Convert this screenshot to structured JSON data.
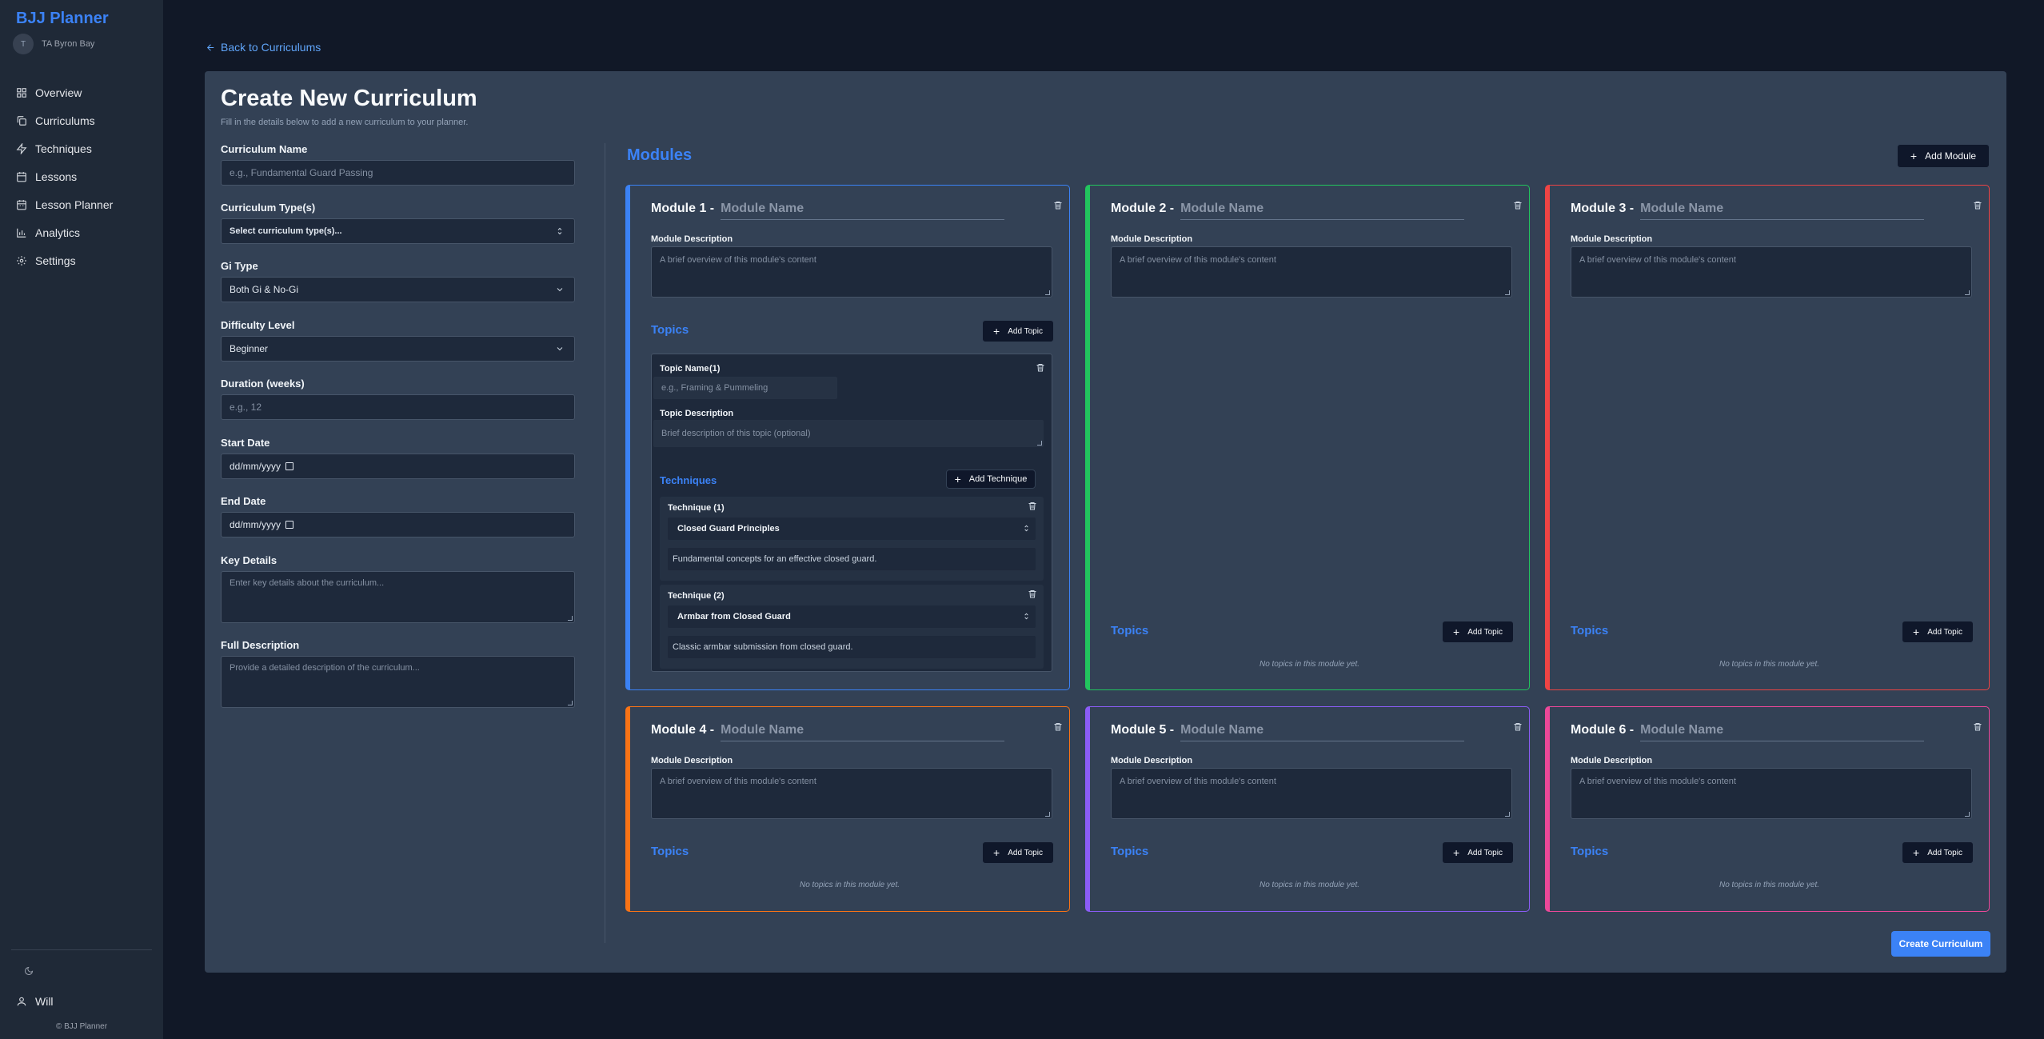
{
  "app": {
    "brand": "BJJ Planner",
    "account_initial": "T",
    "account_name": "TA Byron Bay"
  },
  "nav": [
    {
      "label": "Overview",
      "icon": "grid-icon"
    },
    {
      "label": "Curriculums",
      "icon": "copy-icon"
    },
    {
      "label": "Techniques",
      "icon": "zap-icon"
    },
    {
      "label": "Lessons",
      "icon": "calendar-icon"
    },
    {
      "label": "Lesson Planner",
      "icon": "calendar-icon"
    },
    {
      "label": "Analytics",
      "icon": "bar-chart-icon"
    },
    {
      "label": "Settings",
      "icon": "gear-icon"
    }
  ],
  "footer": {
    "user": "Will",
    "copyright": "© BJJ Planner"
  },
  "back_link": "Back to Curriculums",
  "page": {
    "title": "Create New Curriculum",
    "subtitle": "Fill in the details below to add a new curriculum to your planner."
  },
  "form": {
    "name": {
      "label": "Curriculum Name",
      "placeholder": "e.g., Fundamental Guard Passing"
    },
    "type": {
      "label": "Curriculum Type(s)",
      "value": "Select curriculum type(s)..."
    },
    "gi": {
      "label": "Gi Type",
      "value": "Both Gi & No-Gi"
    },
    "difficulty": {
      "label": "Difficulty Level",
      "value": "Beginner"
    },
    "duration": {
      "label": "Duration (weeks)",
      "placeholder": "e.g., 12"
    },
    "start": {
      "label": "Start Date",
      "value": "dd/mm/yyyy"
    },
    "end": {
      "label": "End Date",
      "value": "dd/mm/yyyy"
    },
    "key_details": {
      "label": "Key Details",
      "placeholder": "Enter key details about the curriculum..."
    },
    "full_description": {
      "label": "Full Description",
      "placeholder": "Provide a detailed description of the curriculum..."
    }
  },
  "modules_section": {
    "title": "Modules",
    "add_label": "Add Module"
  },
  "common": {
    "module_name_placeholder": "Module Name",
    "module_desc_label": "Module Description",
    "module_desc_placeholder": "A brief overview of this module's content",
    "topics_label": "Topics",
    "add_topic": "Add Topic",
    "no_topics": "No topics in this module yet."
  },
  "modules": [
    {
      "label": "Module 1 -",
      "color": "#3b82f6"
    },
    {
      "label": "Module 2 -",
      "color": "#22c55e"
    },
    {
      "label": "Module 3 -",
      "color": "#ef4444"
    },
    {
      "label": "Module 4 -",
      "color": "#f97316"
    },
    {
      "label": "Module 5 -",
      "color": "#8b5cf6"
    },
    {
      "label": "Module 6 -",
      "color": "#ec4899"
    }
  ],
  "topic": {
    "name_label": "Topic Name",
    "index": "(1)",
    "name_placeholder": "e.g., Framing & Pummeling",
    "desc_label": "Topic Description",
    "desc_placeholder": "Brief description of this topic (optional)",
    "techniques_label": "Techniques",
    "add_technique": "Add Technique",
    "techniques": [
      {
        "label": "Technique (1)",
        "value": "Closed Guard Principles",
        "description": "Fundamental concepts for an effective closed guard."
      },
      {
        "label": "Technique (2)",
        "value": "Armbar from Closed Guard",
        "description": "Classic armbar submission from closed guard."
      }
    ]
  },
  "create_button": "Create Curriculum"
}
